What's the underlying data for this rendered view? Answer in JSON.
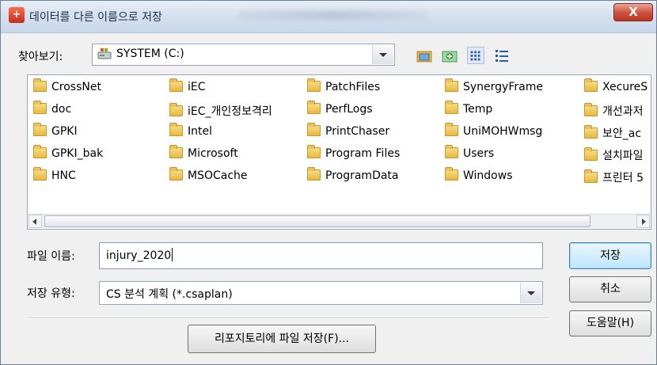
{
  "window": {
    "title": "데이터를 다른 이름으로 저장",
    "app_icon_glyph": "+",
    "close_label": "X"
  },
  "look_in": {
    "label": "찾아보기:",
    "value": "SYSTEM (C:)",
    "icon": "drive-icon"
  },
  "toolbar": {
    "icons": [
      "up-folder-icon",
      "new-folder-icon",
      "list-view-icon",
      "details-view-icon"
    ]
  },
  "files": {
    "columns": [
      [
        "CrossNet",
        "doc",
        "GPKI",
        "GPKI_bak",
        "HNC"
      ],
      [
        "iEC",
        "iEC_개인정보격리",
        "Intel",
        "Microsoft",
        "MSOCache"
      ],
      [
        "PatchFiles",
        "PerfLogs",
        "PrintChaser",
        "Program Files",
        "ProgramData"
      ],
      [
        "SynergyFrame",
        "Temp",
        "UniMOHWmsg",
        "Users",
        "Windows"
      ],
      [
        "XecureS",
        "개선과저",
        "보안_ac",
        "설치파일",
        "프린터 5"
      ]
    ]
  },
  "filename": {
    "label": "파일 이름:",
    "value": "injury_2020"
  },
  "filetype": {
    "label": "저장 유형:",
    "value": "CS 분석 계획 (*.csaplan)"
  },
  "buttons": {
    "save": "저장",
    "cancel": "취소",
    "help": "도움말(H)",
    "repository": "리포지토리에 파일 저장(F)..."
  },
  "colors": {
    "default_button_border": "#3c7fb1",
    "folder": "#e8b93f"
  }
}
